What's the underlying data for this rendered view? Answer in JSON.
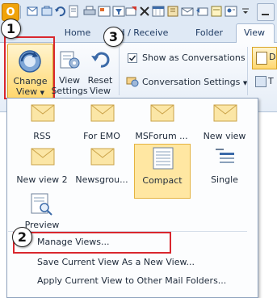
{
  "tabs": {
    "home": "Home",
    "send_receive": "d / Receive",
    "folder": "Folder",
    "view": "View"
  },
  "ribbon": {
    "change_view": {
      "line1": "Change",
      "line2": "View"
    },
    "view_settings": {
      "line1": "View",
      "line2": "Settings"
    },
    "reset_view": {
      "line1": "Reset",
      "line2": "View"
    },
    "show_as_conversations": {
      "label": "Show as Conversations",
      "checked": true
    },
    "conversation_settings": "Conversation Settings",
    "right_icons": [
      "D",
      "T"
    ]
  },
  "gallery": {
    "row1": [
      "RSS",
      "For EMO",
      "MSForum ...",
      "New view"
    ],
    "row2": [
      "New view 2",
      "Newsgrou...",
      "Compact",
      "Single"
    ],
    "row3": [
      "Preview"
    ],
    "selected": "Compact"
  },
  "menu": {
    "manage_views": "Manage Views...",
    "save_view": "Save Current View As a New View...",
    "apply_view": "Apply Current View to Other Mail Folders..."
  },
  "callouts": {
    "one": "1",
    "two": "2",
    "three": "3"
  },
  "colors": {
    "highlight_red": "#d9272e",
    "selected_item": "#ffe7a2",
    "ribbon_blue": "#dfe9f5"
  }
}
